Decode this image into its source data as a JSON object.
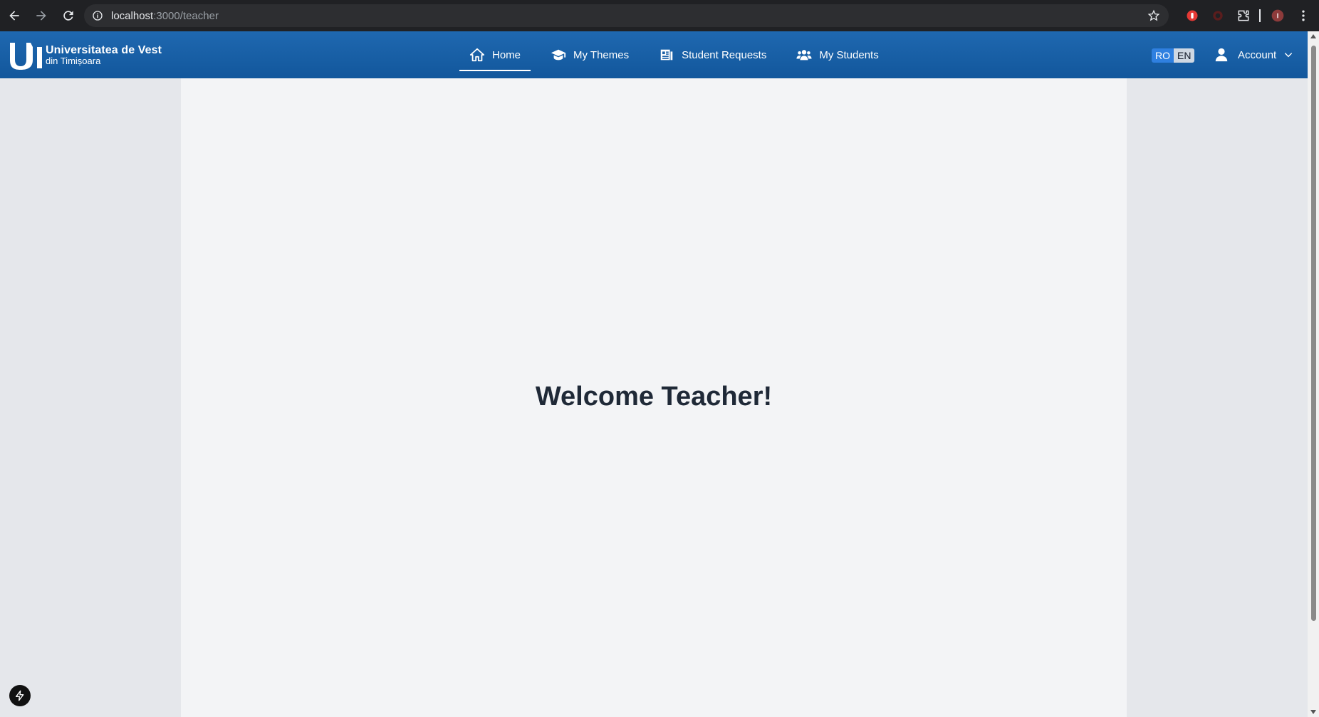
{
  "browser": {
    "url_host": "localhost",
    "url_path": ":3000/teacher"
  },
  "header": {
    "logo_line1": "Universitatea de Vest",
    "logo_line2": "din Timișoara",
    "nav": [
      {
        "label": "Home",
        "icon": "home-icon",
        "active": true
      },
      {
        "label": "My Themes",
        "icon": "graduation-cap-icon",
        "active": false
      },
      {
        "label": "Student Requests",
        "icon": "document-list-icon",
        "active": false
      },
      {
        "label": "My Students",
        "icon": "users-icon",
        "active": false
      }
    ],
    "lang": {
      "ro": "RO",
      "en": "EN",
      "selected": "RO"
    },
    "account_label": "Account"
  },
  "main": {
    "welcome_text": "Welcome Teacher!"
  },
  "colors": {
    "header_bg": "#1a5fa6",
    "page_bg": "#f3f4f6",
    "side_bg": "#e5e7eb",
    "title_text": "#1f2937"
  }
}
